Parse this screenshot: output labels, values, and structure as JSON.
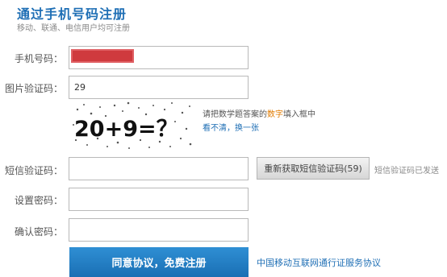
{
  "header": {
    "title": "通过手机号码注册",
    "subtitle": "移动、联通、电信用户均可注册"
  },
  "form": {
    "phone_label": "手机号码：",
    "captcha_label": "图片验证码：",
    "captcha_value": "29",
    "captcha_image_text": "20+9=？",
    "captcha_tip_before": "请把数学题答案的",
    "captcha_tip_highlight": "数字",
    "captcha_tip_after": "填入框中",
    "captcha_unclear": "看不清，",
    "captcha_refresh": "换一张",
    "sms_label": "短信验证码：",
    "sms_button": "重新获取短信验证码(59)",
    "sms_sent_note": "短信验证码已发送",
    "password_label": "设置密码：",
    "confirm_label": "确认密码：",
    "submit_button": "同意协议，免费注册",
    "agreement_link": "中国移动互联网通行证服务协议"
  },
  "colors": {
    "accent": "#1f6fb5",
    "highlight": "#e07b00",
    "redaction": "#cf3a3e"
  }
}
